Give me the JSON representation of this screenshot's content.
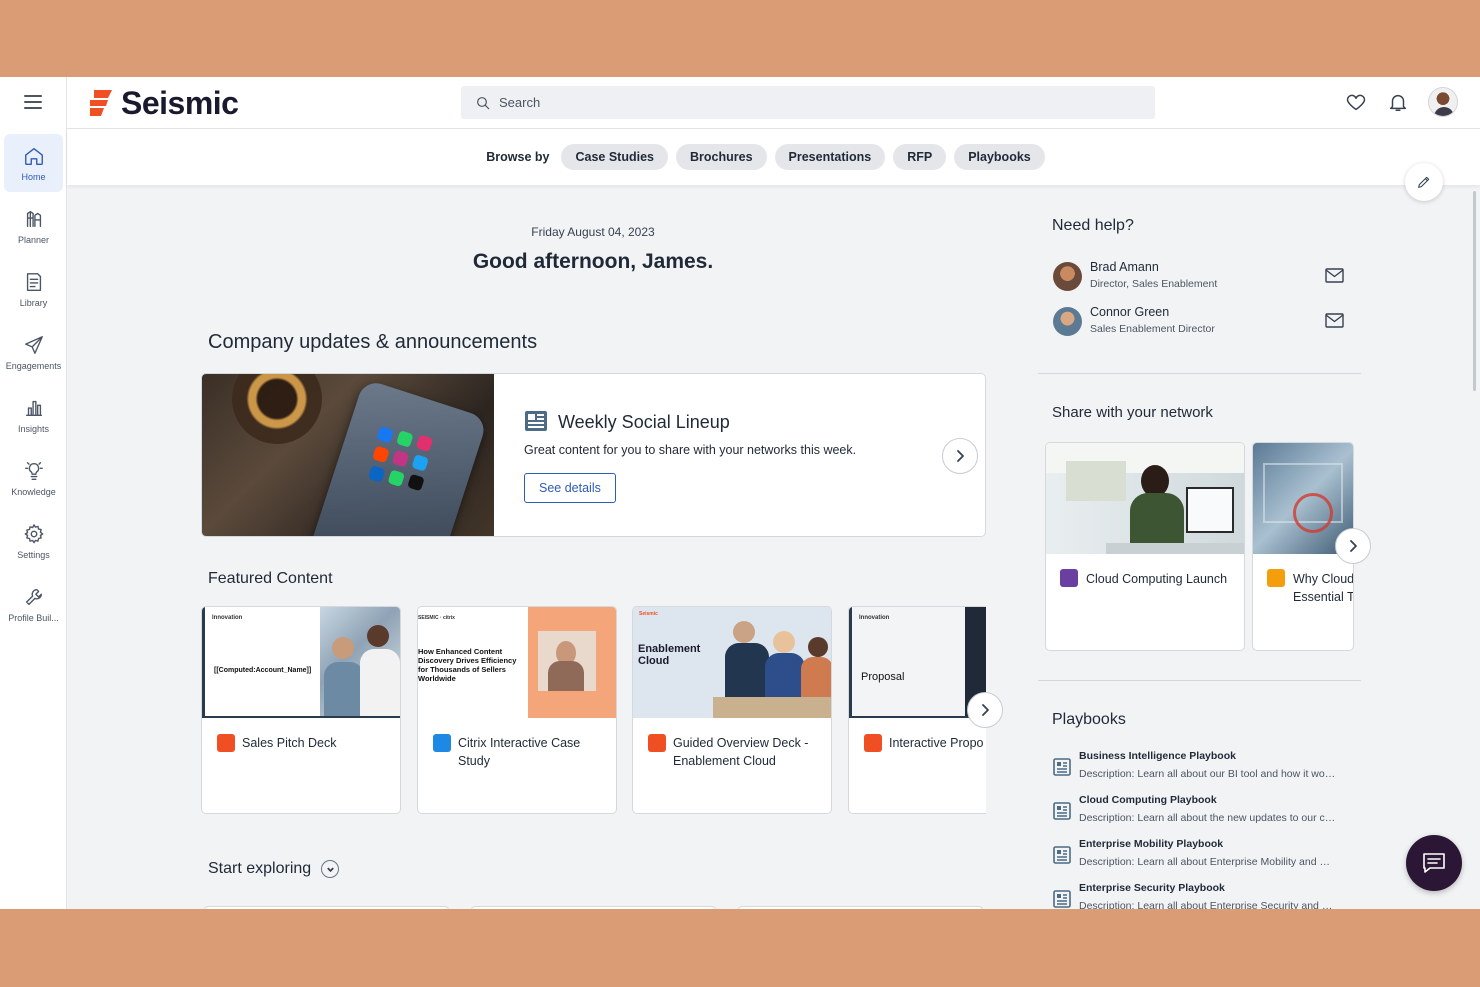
{
  "brand": {
    "name": "Seismic",
    "accent": "#f04e23",
    "primary": "#2e5bb8"
  },
  "search": {
    "placeholder": "Search"
  },
  "header_icons": [
    "heart-icon",
    "bell-icon",
    "user-avatar"
  ],
  "sidebar": {
    "items": [
      {
        "label": "Home",
        "icon": "home-icon",
        "active": true
      },
      {
        "label": "Planner",
        "icon": "planner-icon"
      },
      {
        "label": "Library",
        "icon": "library-icon"
      },
      {
        "label": "Engagements",
        "icon": "paper-plane-icon"
      },
      {
        "label": "Insights",
        "icon": "bar-chart-icon"
      },
      {
        "label": "Knowledge",
        "icon": "lightbulb-icon"
      },
      {
        "label": "Settings",
        "icon": "gear-icon"
      },
      {
        "label": "Profile Buil...",
        "icon": "wrench-icon"
      }
    ]
  },
  "browse": {
    "label": "Browse by",
    "chips": [
      "Case Studies",
      "Brochures",
      "Presentations",
      "RFP",
      "Playbooks"
    ]
  },
  "main": {
    "date": "Friday August 04, 2023",
    "greeting": "Good afternoon, James.",
    "announcements_title": "Company updates & announcements",
    "announcement": {
      "title": "Weekly Social Lineup",
      "description": "Great content for you to share with your networks this week.",
      "button": "See details"
    },
    "featured_title": "Featured Content",
    "featured": [
      {
        "title": "Sales Pitch Deck",
        "thumb_text": "[[Computed:Account_Name]]",
        "thumb_brand": "Innovation"
      },
      {
        "title": "Citrix Interactive Case Study",
        "thumb_text": "How Enhanced Content Discovery Drives Efficiency for Thousands of Sellers Worldwide",
        "thumb_brand": "SEISMIC · citrix"
      },
      {
        "title": "Guided Overview Deck - Enablement Cloud",
        "thumb_text": "Enablement Cloud",
        "thumb_brand": "Seismic"
      },
      {
        "title": "Interactive Propo",
        "thumb_text": "Proposal",
        "thumb_brand": "Innovation"
      }
    ],
    "explore_title": "Start exploring"
  },
  "help": {
    "title": "Need help?",
    "contacts": [
      {
        "name": "Brad Amann",
        "role": "Director, Sales Enablement"
      },
      {
        "name": "Connor Green",
        "role": "Sales Enablement Director"
      }
    ]
  },
  "network": {
    "title": "Share with your network",
    "items": [
      {
        "title": "Cloud Computing Launch",
        "icon_color": "#6b3fa0"
      },
      {
        "title_line1": "Why Cloud",
        "title_line2": "Essential T",
        "icon_color": "#f59e0b"
      }
    ]
  },
  "playbooks": {
    "title": "Playbooks",
    "items": [
      {
        "name": "Business Intelligence Playbook",
        "desc": "Description: Learn all about our BI tool and how it works"
      },
      {
        "name": "Cloud Computing Playbook",
        "desc": "Description: Learn all about the new updates to our cloud"
      },
      {
        "name": "Enterprise Mobility Playbook",
        "desc": "Description: Learn all about Enterprise Mobility and more"
      },
      {
        "name": "Enterprise Security Playbook",
        "desc": "Description: Learn all about Enterprise Security and more"
      }
    ]
  }
}
